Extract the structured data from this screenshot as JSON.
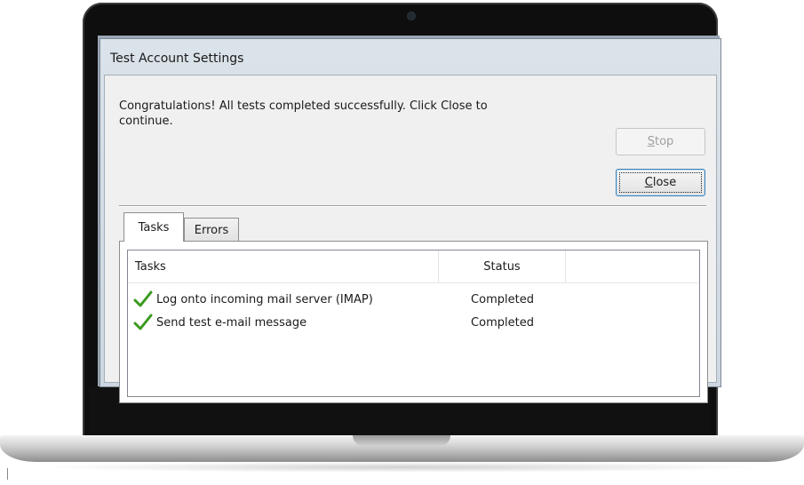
{
  "dialog": {
    "title": "Test Account Settings",
    "message": "Congratulations! All tests completed successfully. Click Close to continue.",
    "stop_button": {
      "accel": "S",
      "rest": "top",
      "enabled": false
    },
    "close_button": {
      "accel": "C",
      "rest": "lose",
      "enabled": true,
      "focused": true
    }
  },
  "tabs": [
    {
      "label": "Tasks",
      "selected": true
    },
    {
      "label": "Errors",
      "selected": false
    }
  ],
  "task_list": {
    "columns": [
      "Tasks",
      "Status"
    ],
    "rows": [
      {
        "icon": "green-checkmark-icon",
        "task": "Log onto incoming mail server (IMAP)",
        "status": "Completed"
      },
      {
        "icon": "green-checkmark-icon",
        "task": "Send test e-mail message",
        "status": "Completed"
      }
    ]
  },
  "colors": {
    "check_green": "#3a9a1f",
    "focus_border": "#3c7fb1",
    "disabled_text": "#a0a0a0"
  }
}
